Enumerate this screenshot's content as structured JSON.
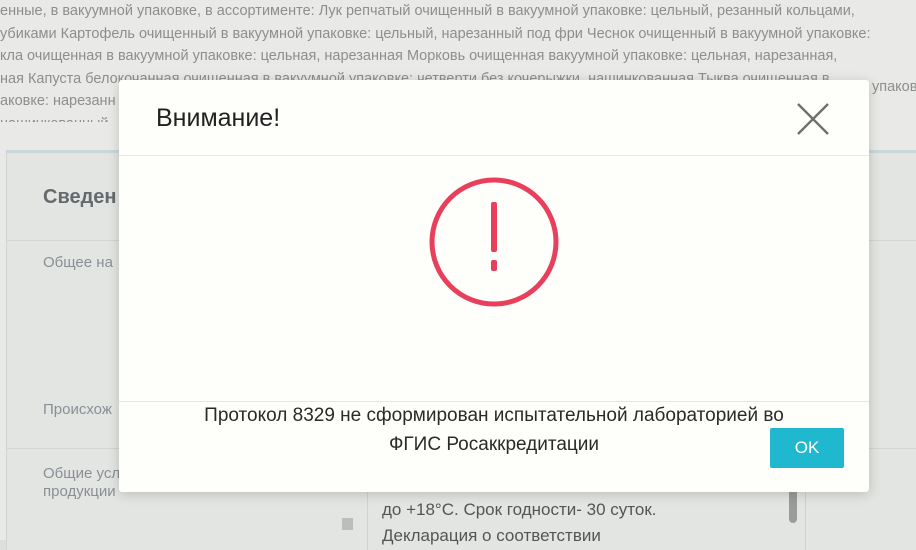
{
  "background": {
    "text_lines": [
      "енные, в вакуумной упаковке, в ассортименте: Лук репчатый очищенный в вакуумной упаковке: цельный, резанный кольцами,",
      "убиками Картофель очищенный в вакуумной упаковке: цельный, нарезанный под фри Чеснок очищенный в вакуумной упаковке:",
      "кла очищенная в вакуумной упаковке: цельная, нарезанная Морковь очищенная вакуумной упаковке: цельная, нарезанная,",
      "ная Капуста белокочанная очищенная в вакуумной упаковке: четверти без кочерыжки, нашинкованная Тыква очищенная в",
      "аковке: нарезанн",
      "нашинкованный"
    ],
    "right_fragment": "упаков",
    "card_title": "Сведен",
    "labels": {
      "general_name": "Общее на",
      "origin": "Происхож",
      "conditions_line1": "Общие усл",
      "conditions_line2": "продукции"
    },
    "value_lines": [
      "до +18°С. Срок годности- 30 суток.",
      "Декларация о соответствии"
    ]
  },
  "modal": {
    "title": "Внимание!",
    "message_line1": "Протокол 8329 не сформирован испытательной лабораторией во",
    "message_line2": "ФГИС Росаккредитации",
    "ok_label": "OK",
    "icon": "alert-exclamation-icon",
    "colors": {
      "alert": "#e8405c",
      "ok_button": "#1fb8cf"
    }
  }
}
